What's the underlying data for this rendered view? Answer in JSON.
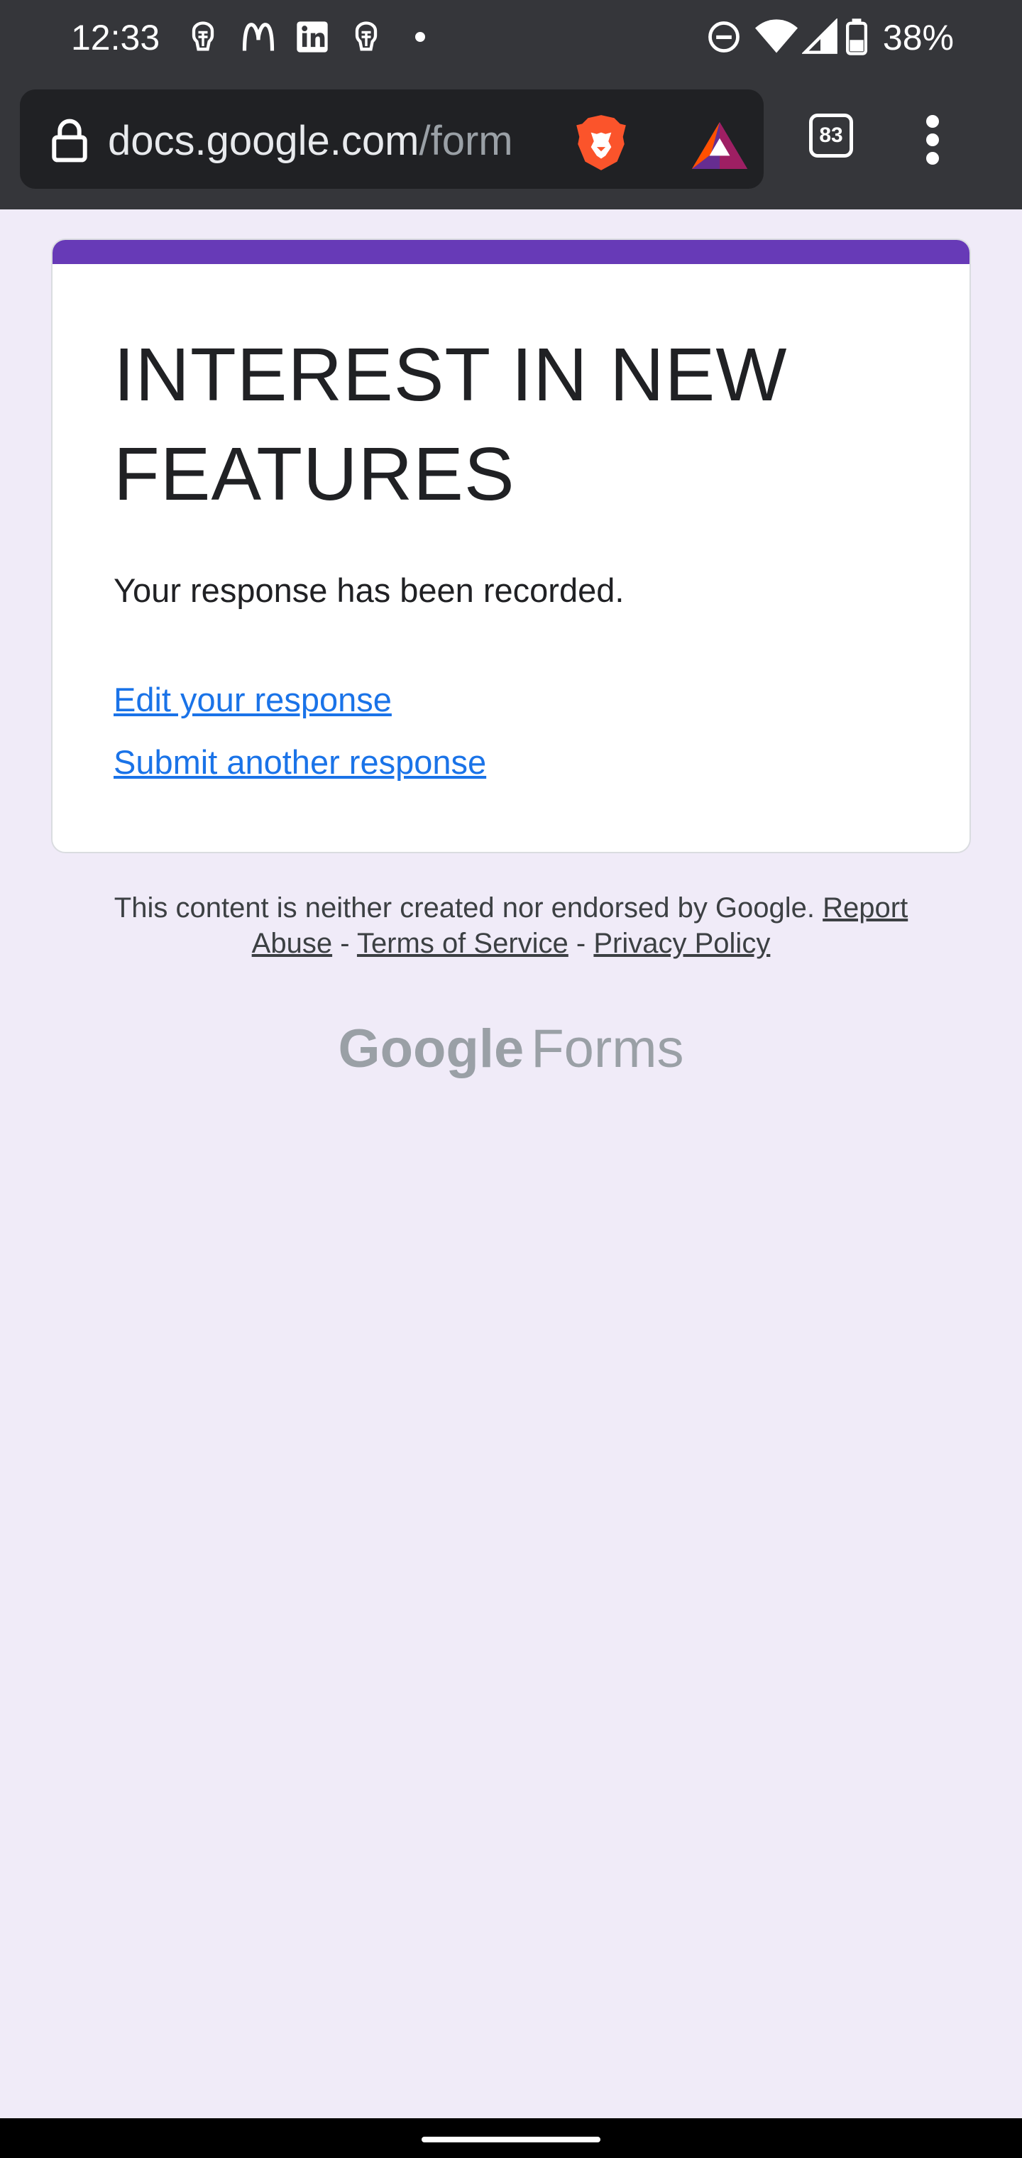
{
  "status_bar": {
    "time": "12:33",
    "battery": "38%",
    "notification_icons": [
      "ai-app-icon",
      "mcdonalds-icon",
      "linkedin-icon",
      "ai-app-icon",
      "dot-icon"
    ],
    "system_icons": [
      "do-not-disturb-icon",
      "wifi-icon",
      "signal-icon",
      "battery-icon"
    ]
  },
  "browser": {
    "url_host": "docs.google.com",
    "url_path": "/form",
    "tab_count": "83"
  },
  "form": {
    "accent_color": "#673ab7",
    "title": "INTEREST IN NEW FEATURES",
    "confirmation": "Your response has been recorded.",
    "edit_link": "Edit your response",
    "submit_another_link": "Submit another response"
  },
  "footer": {
    "disclaimer": "This content is neither created nor endorsed by Google.",
    "report_abuse": "Report Abuse",
    "separator": "-",
    "terms": "Terms of Service",
    "privacy": "Privacy Policy",
    "brand_google": "Google",
    "brand_forms": "Forms"
  }
}
